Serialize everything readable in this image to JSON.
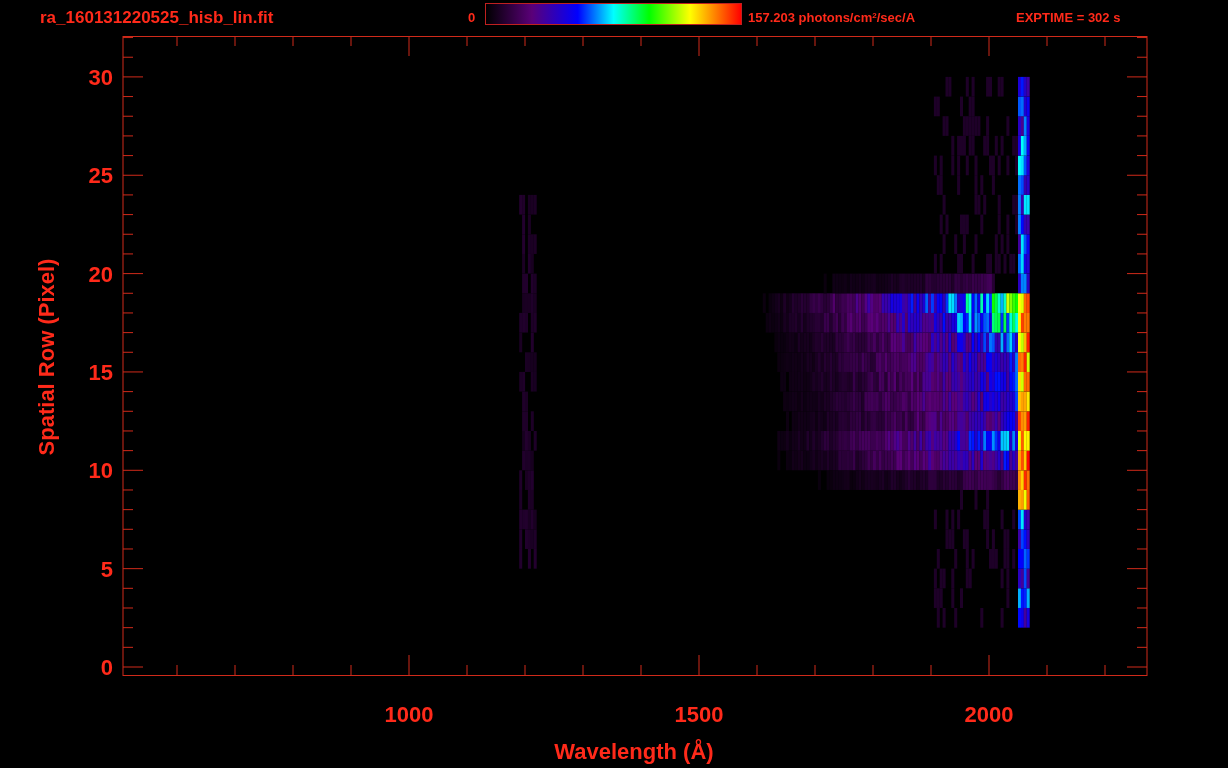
{
  "header": {
    "filename": "ra_160131220525_hisb_lin.fit",
    "colorbar_min": "0",
    "colorbar_max": "157.203 photons/cm$^{2}$/sec/A",
    "exptime": "EXPTIME = 302 s"
  },
  "plot": {
    "xlabel": "Wavelength (Å)",
    "ylabel": "Spatial Row (Pixel)",
    "xtick_labels": [
      "1000",
      "1500",
      "2000"
    ],
    "ytick_labels": [
      "30",
      "25",
      "20",
      "15",
      "10",
      "5",
      "0"
    ]
  }
}
